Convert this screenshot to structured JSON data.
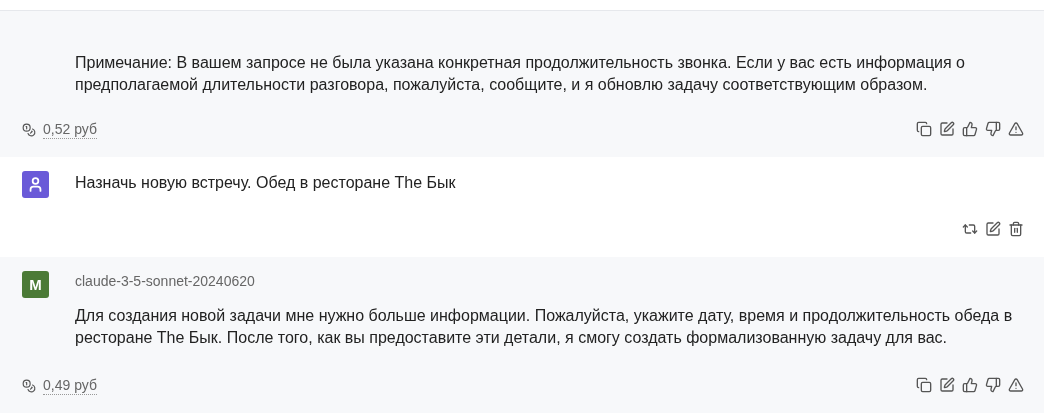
{
  "messages": [
    {
      "kind": "assistant",
      "text": "Примечание: В вашем запросе не была указана конкретная продолжительность звонка. Если у вас есть информация о предполагаемой длительности разговора, пожалуйста, сообщите, и я обновлю задачу соответствующим образом.",
      "cost": "0,52 руб"
    },
    {
      "kind": "user",
      "text": "Назначь новую встречу. Обед в ресторане The Бык"
    },
    {
      "kind": "assistant",
      "author": "claude-3-5-sonnet-20240620",
      "avatar": "M",
      "text": "Для создания новой задачи мне нужно больше информации. Пожалуйста, укажите дату, время и продолжительность обеда в ресторане The Бык. После того, как вы предоставите эти детали, я смогу создать формализованную задачу для вас.",
      "cost": "0,49 руб"
    }
  ]
}
